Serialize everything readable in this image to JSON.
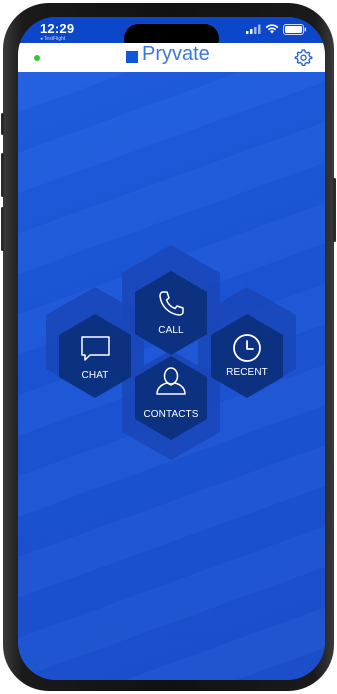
{
  "status_bar": {
    "time": "12:29",
    "carrier": "◂ TestFlight"
  },
  "app_bar": {
    "logo_text": "Pryvate",
    "presence": "online",
    "settings_icon": "gear-icon"
  },
  "menu": {
    "call_label": "CALL",
    "chat_label": "CHAT",
    "recent_label": "RECENT",
    "contacts_label": "CONTACTS"
  },
  "colors": {
    "background_blue": "#1c55d6",
    "hex_dark": "#0b2f78",
    "hex_outer": "#1846b6",
    "presence_green": "#31c92e"
  }
}
